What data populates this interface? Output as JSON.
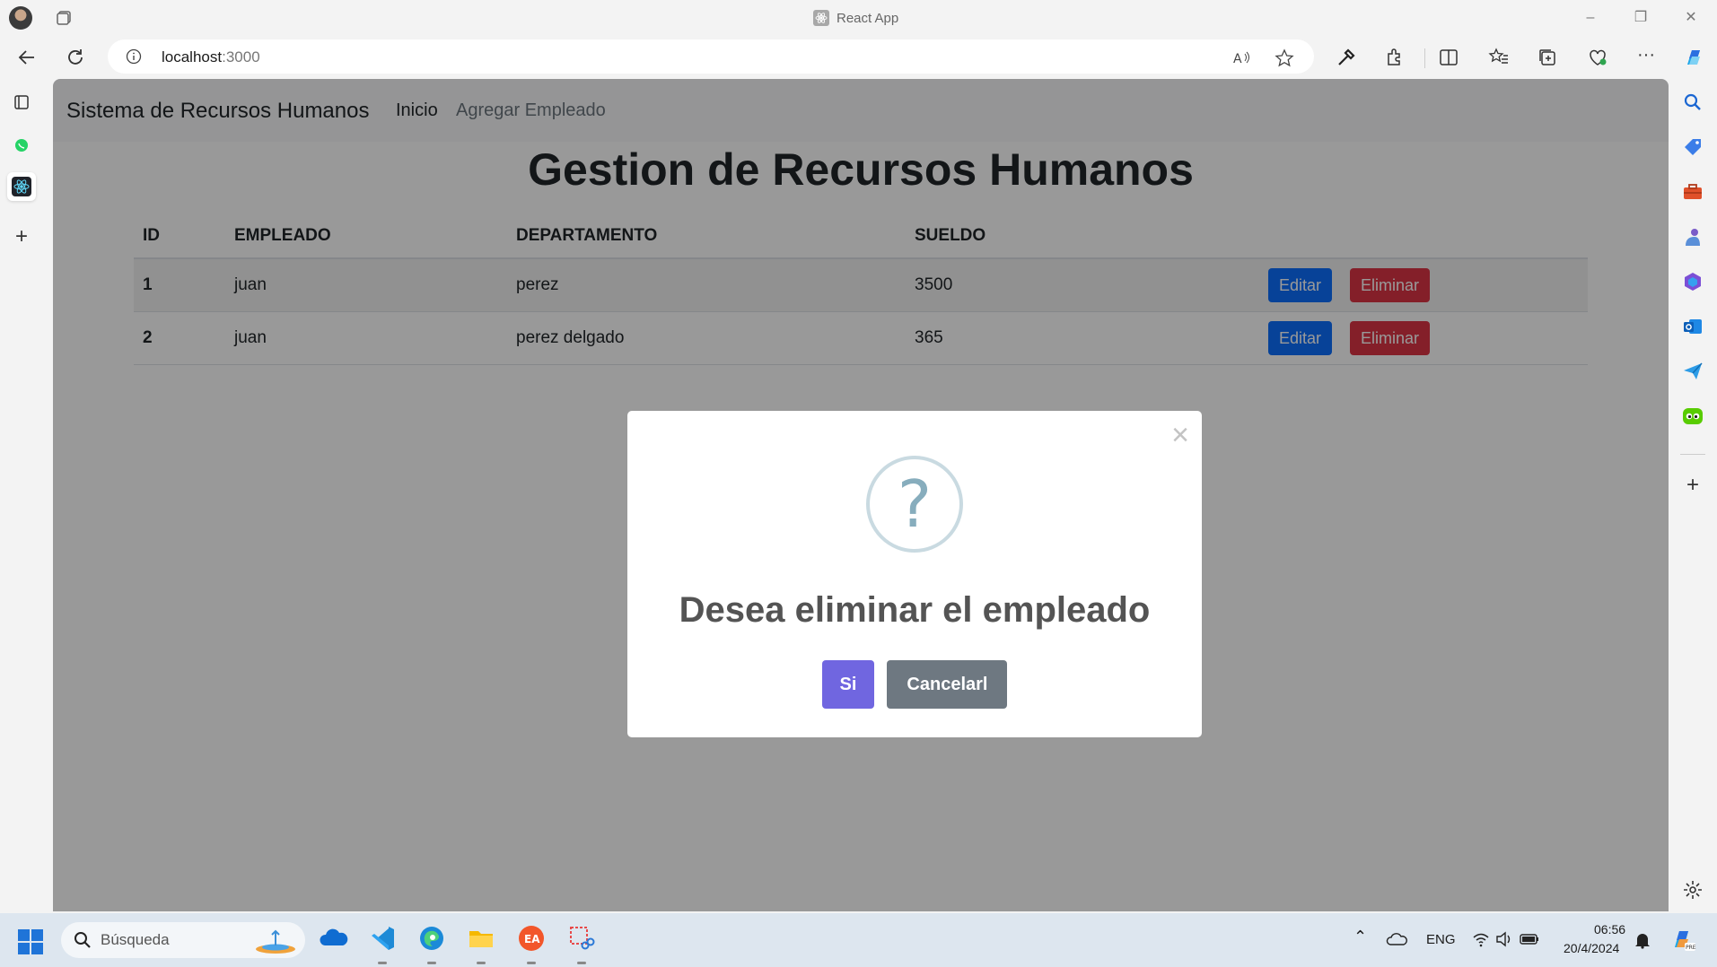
{
  "browser": {
    "window_title": "React App",
    "url_host": "localhost",
    "url_port": ":3000"
  },
  "app": {
    "brand": "Sistema de Recursos Humanos",
    "nav": [
      {
        "label": "Inicio"
      },
      {
        "label": "Agregar Empleado"
      }
    ],
    "page_title": "Gestion de Recursos Humanos"
  },
  "table": {
    "headers": [
      "ID",
      "EMPLEADO",
      "DEPARTAMENTO",
      "SUELDO"
    ],
    "rows": [
      {
        "id": "1",
        "empleado": "juan",
        "departamento": "perez",
        "sueldo": "3500"
      },
      {
        "id": "2",
        "empleado": "juan",
        "departamento": "perez delgado",
        "sueldo": "365"
      }
    ],
    "edit_label": "Editar",
    "delete_label": "Eliminar"
  },
  "modal": {
    "close_glyph": "×",
    "icon_glyph": "?",
    "title": "Desea eliminar el empleado",
    "confirm_label": "Si",
    "cancel_label": "Cancelarl",
    "confirm_color": "#7066e0",
    "cancel_color": "#6e7881"
  },
  "taskbar": {
    "search_placeholder": "Búsqueda",
    "language": "ENG",
    "time": "06:56",
    "date": "20/4/2024"
  },
  "colors": {
    "primary": "#0d6efd",
    "danger": "#dc3545",
    "taskbar": "#dde6ef"
  }
}
